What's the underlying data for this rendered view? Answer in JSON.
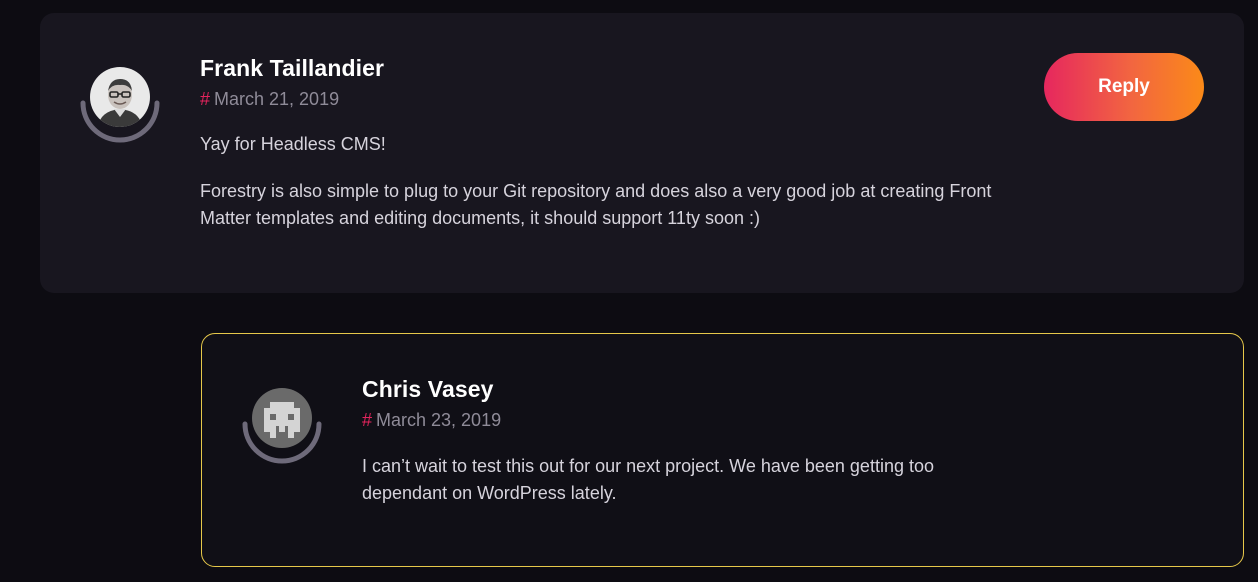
{
  "comments": [
    {
      "author": "Frank Taillandier",
      "date_hash": "#",
      "date": "March 21, 2019",
      "paragraphs": [
        "Yay for Headless CMS!",
        "Forestry is also simple to plug to your Git repository and does also a very good job at creating Front Matter templates and editing documents, it should support 11ty soon :)"
      ],
      "action_label": "Reply",
      "avatar_icon": "person-photo-icon"
    },
    {
      "author": "Chris Vasey",
      "date_hash": "#",
      "date": "March 23, 2019",
      "paragraphs": [
        "I can’t wait to test this out for our next project. We have been getting too dependant on WordPress lately."
      ],
      "avatar_icon": "pixel-invader-icon"
    }
  ],
  "colors": {
    "background": "#0d0c12",
    "card": "#18161f",
    "reply_border": "#e6c84a",
    "hash_accent": "#e4245d",
    "button_gradient_start": "#e6275e",
    "button_gradient_end": "#fb8a18"
  }
}
